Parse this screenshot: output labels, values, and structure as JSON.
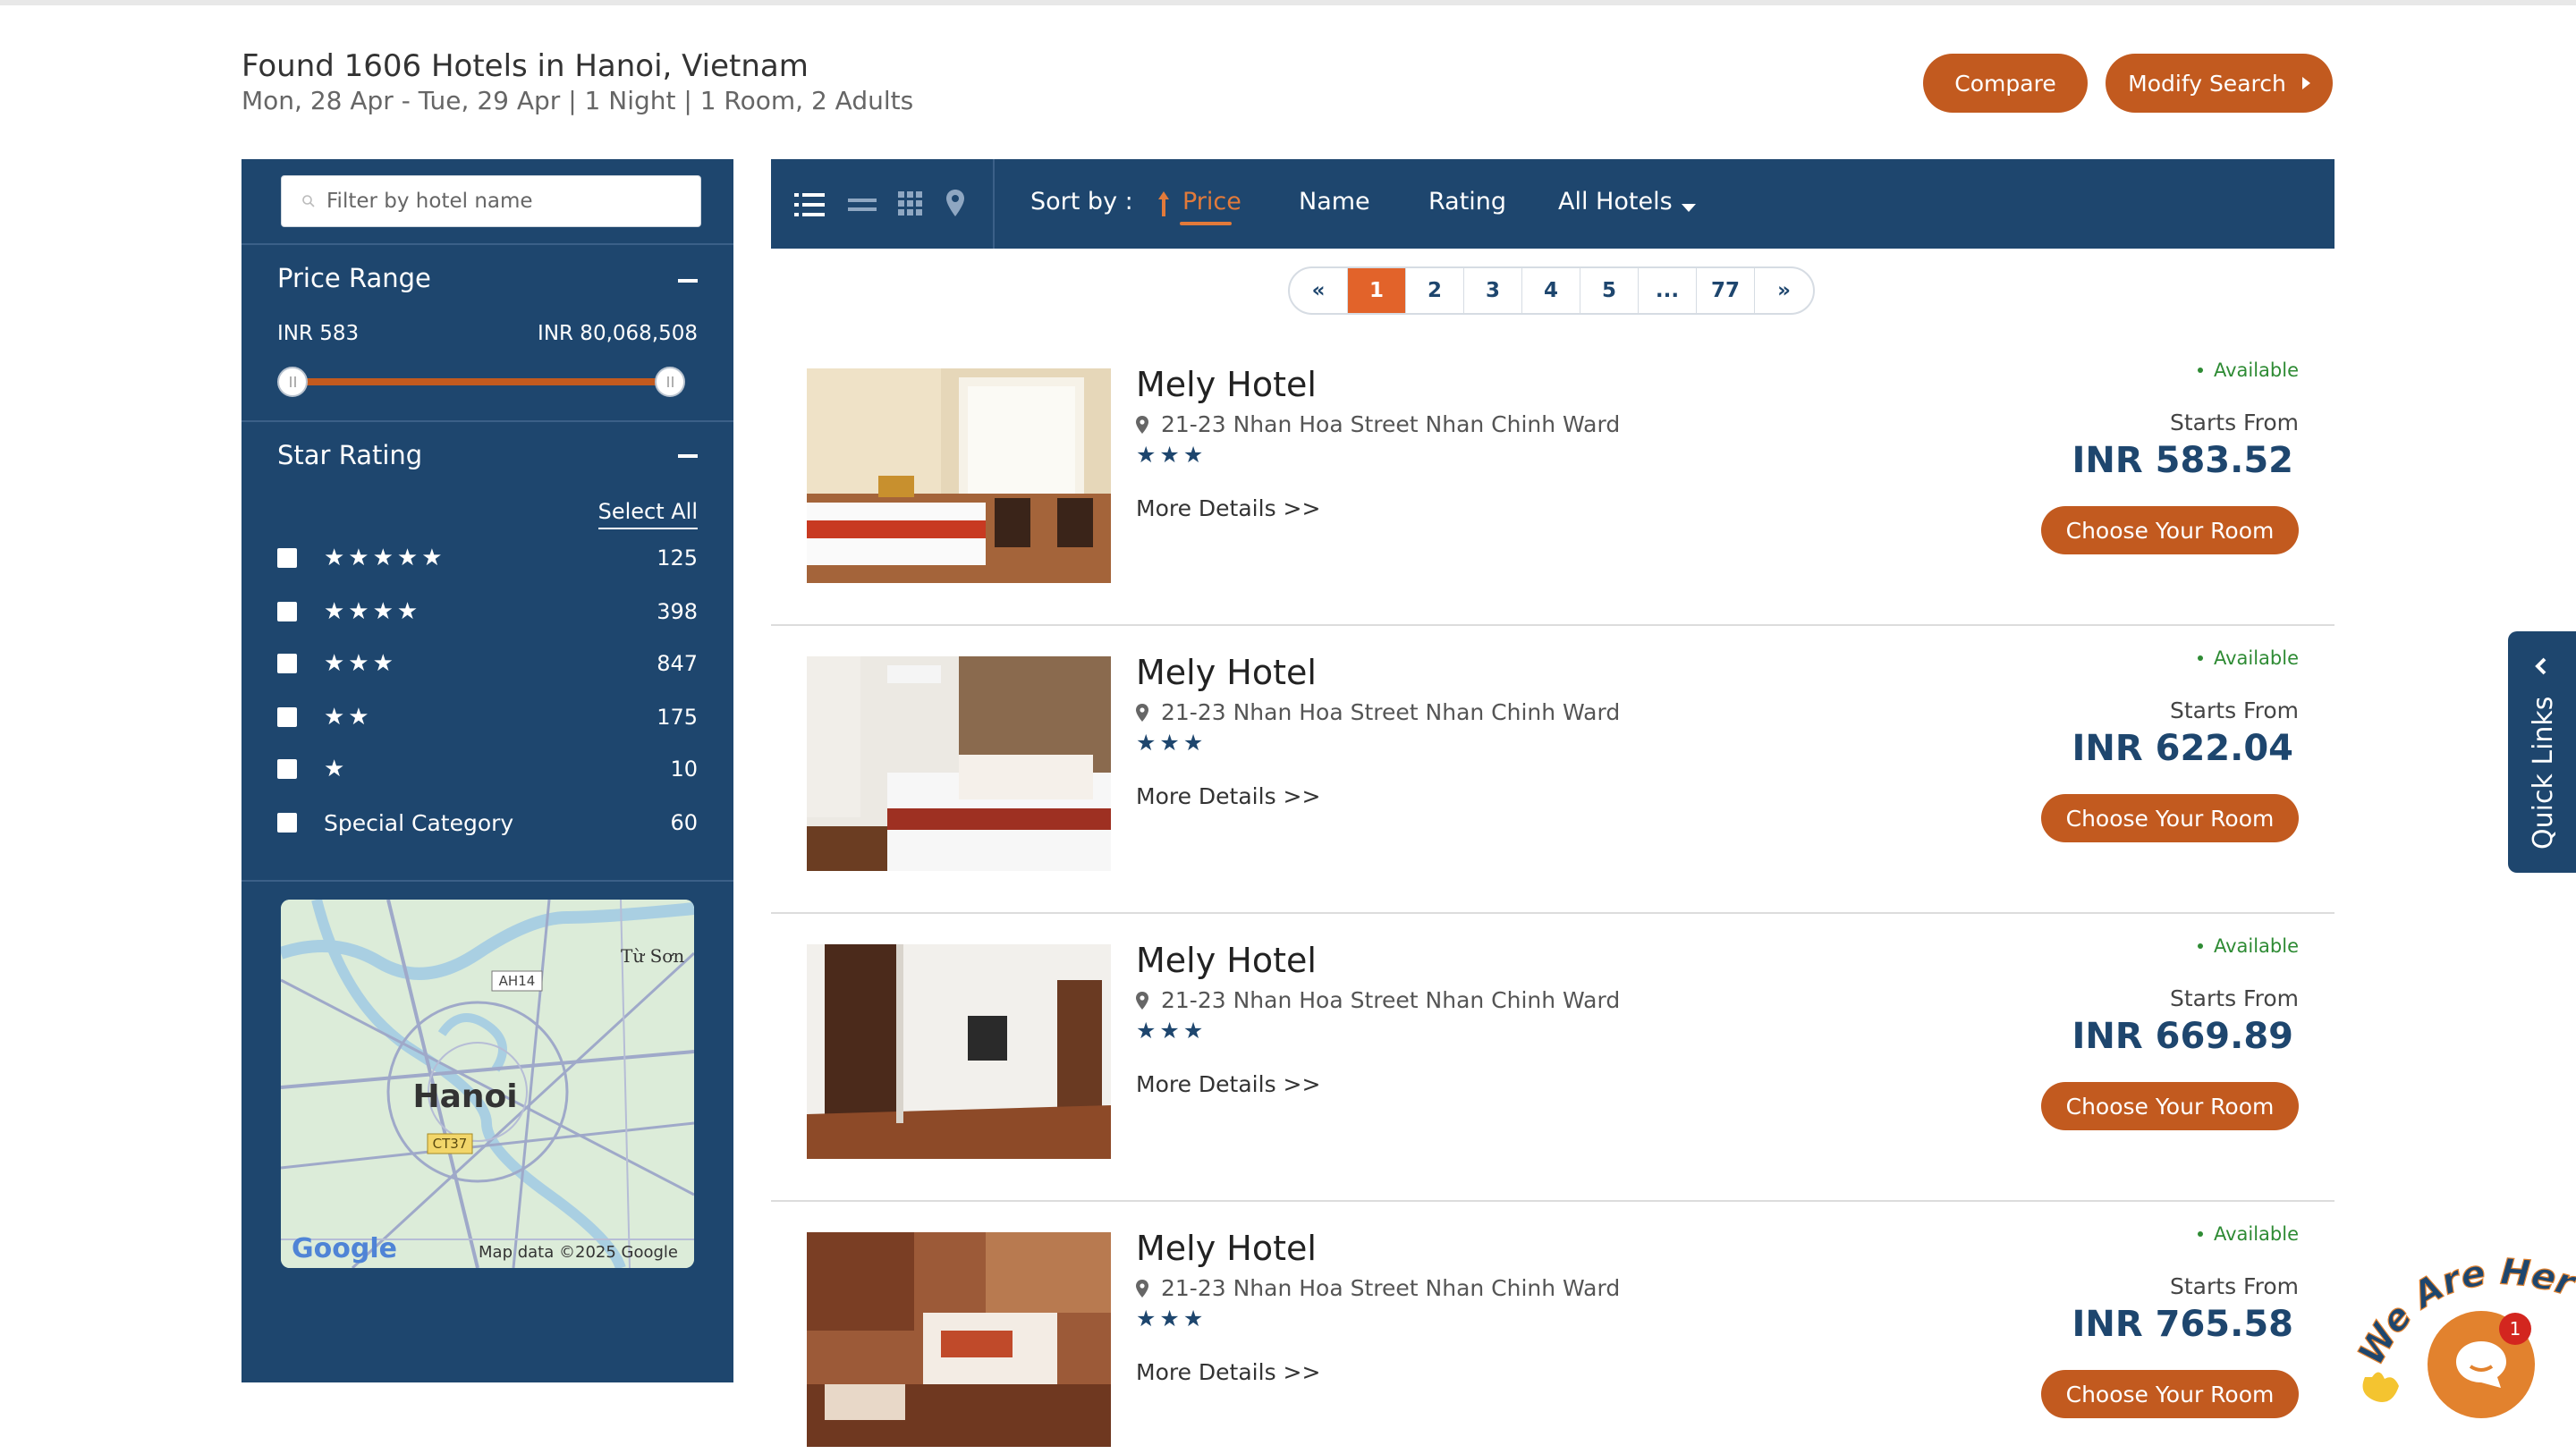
{
  "header": {
    "title": "Found 1606 Hotels in Hanoi, Vietnam",
    "subtitle": "Mon, 28 Apr - Tue, 29 Apr | 1 Night | 1 Room, 2 Adults",
    "compare_label": "Compare",
    "modify_label": "Modify Search"
  },
  "sidebar": {
    "filter_placeholder": "Filter by hotel name",
    "price_range": {
      "title": "Price Range",
      "min_label": "INR 583",
      "max_label": "INR 80,068,508",
      "selected_min_fraction": 0.0,
      "selected_max_fraction": 1.0
    },
    "star_rating": {
      "title": "Star Rating",
      "select_all": "Select All",
      "rows": [
        {
          "stars": "★★★★★",
          "count": "125"
        },
        {
          "stars": "★★★★",
          "count": "398"
        },
        {
          "stars": "★★★",
          "count": "847"
        },
        {
          "stars": "★★",
          "count": "175"
        },
        {
          "stars": "★",
          "count": "10"
        },
        {
          "label": "Special Category",
          "count": "60"
        }
      ]
    },
    "map": {
      "city": "Hanoi",
      "town": "Từ Sơn",
      "road1": "AH14",
      "road2": "CT37",
      "logo": "Google",
      "credit": "Map data ©2025 Google"
    }
  },
  "toolbar": {
    "views": [
      "list-view-icon",
      "compact-view-icon",
      "grid-view-icon",
      "map-view-icon"
    ],
    "sort_label": "Sort by :",
    "sort_options": [
      "Price",
      "Name",
      "Rating"
    ],
    "active_sort": "Price",
    "filter_dropdown": "All Hotels"
  },
  "pagination": {
    "prev": "«",
    "pages": [
      "1",
      "2",
      "3",
      "4",
      "5",
      "...",
      "77"
    ],
    "next": "»",
    "current": "1"
  },
  "hotels": [
    {
      "name": "Mely Hotel",
      "address": "21-23 Nhan Hoa Street Nhan Chinh Ward",
      "stars": "★★★",
      "more": "More Details >>",
      "availability": "Available",
      "starts_from": "Starts From",
      "price": "INR 583.52",
      "cta": "Choose Your Room"
    },
    {
      "name": "Mely Hotel",
      "address": "21-23 Nhan Hoa Street Nhan Chinh Ward",
      "stars": "★★★",
      "more": "More Details >>",
      "availability": "Available",
      "starts_from": "Starts From",
      "price": "INR 622.04",
      "cta": "Choose Your Room"
    },
    {
      "name": "Mely Hotel",
      "address": "21-23 Nhan Hoa Street Nhan Chinh Ward",
      "stars": "★★★",
      "more": "More Details >>",
      "availability": "Available",
      "starts_from": "Starts From",
      "price": "INR 669.89",
      "cta": "Choose Your Room"
    },
    {
      "name": "Mely Hotel",
      "address": "21-23 Nhan Hoa Street Nhan Chinh Ward",
      "stars": "★★★",
      "more": "More Details >>",
      "availability": "Available",
      "starts_from": "Starts From",
      "price": "INR 765.58",
      "cta": "Choose Your Room"
    }
  ],
  "quick_links": {
    "label": "Quick Links"
  },
  "chat": {
    "banner": "We Are Here!",
    "unread": "1"
  },
  "colors": {
    "navy": "#1e466e",
    "accent": "#c25a1f",
    "active_orange": "#e2632a",
    "available_green": "#2e8b34"
  }
}
